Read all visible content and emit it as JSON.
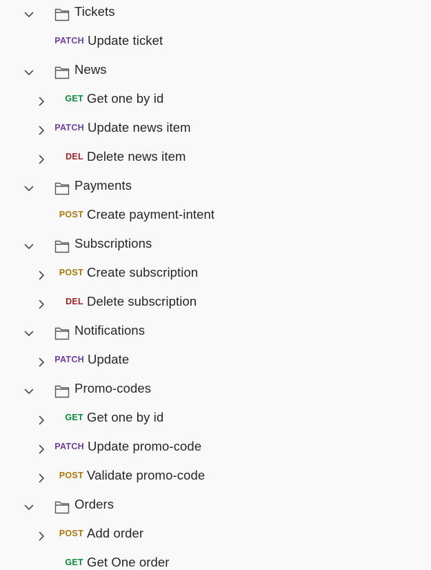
{
  "methods": {
    "PATCH": {
      "label": "PATCH",
      "color": "#6e3e9a"
    },
    "GET": {
      "label": "GET",
      "color": "#0b8a3b"
    },
    "DEL": {
      "label": "DEL",
      "color": "#9a2424"
    },
    "POST": {
      "label": "POST",
      "color": "#a8770a"
    }
  },
  "icons": {
    "folder": "folder-icon",
    "expanded": "chevron-down-icon",
    "collapsed": "chevron-right-icon"
  },
  "tree": [
    {
      "type": "folder",
      "label": "Tickets",
      "expanded": true
    },
    {
      "type": "request",
      "method": "PATCH",
      "label": "Update ticket",
      "expandable": false
    },
    {
      "type": "folder",
      "label": "News",
      "expanded": true
    },
    {
      "type": "request",
      "method": "GET",
      "label": "Get one by id",
      "expandable": true
    },
    {
      "type": "request",
      "method": "PATCH",
      "label": "Update news item",
      "expandable": true
    },
    {
      "type": "request",
      "method": "DEL",
      "label": "Delete news item",
      "expandable": true
    },
    {
      "type": "folder",
      "label": "Payments",
      "expanded": true
    },
    {
      "type": "request",
      "method": "POST",
      "label": "Create payment-intent",
      "expandable": false
    },
    {
      "type": "folder",
      "label": "Subscriptions",
      "expanded": true
    },
    {
      "type": "request",
      "method": "POST",
      "label": "Create subscription",
      "expandable": true
    },
    {
      "type": "request",
      "method": "DEL",
      "label": "Delete subscription",
      "expandable": true
    },
    {
      "type": "folder",
      "label": "Notifications",
      "expanded": true
    },
    {
      "type": "request",
      "method": "PATCH",
      "label": "Update",
      "expandable": true
    },
    {
      "type": "folder",
      "label": "Promo-codes",
      "expanded": true
    },
    {
      "type": "request",
      "method": "GET",
      "label": "Get one by id",
      "expandable": true
    },
    {
      "type": "request",
      "method": "PATCH",
      "label": "Update promo-code",
      "expandable": true
    },
    {
      "type": "request",
      "method": "POST",
      "label": "Validate promo-code",
      "expandable": true
    },
    {
      "type": "folder",
      "label": "Orders",
      "expanded": true
    },
    {
      "type": "request",
      "method": "POST",
      "label": "Add order",
      "expandable": true
    },
    {
      "type": "request",
      "method": "GET",
      "label": "Get One order",
      "expandable": false
    }
  ]
}
